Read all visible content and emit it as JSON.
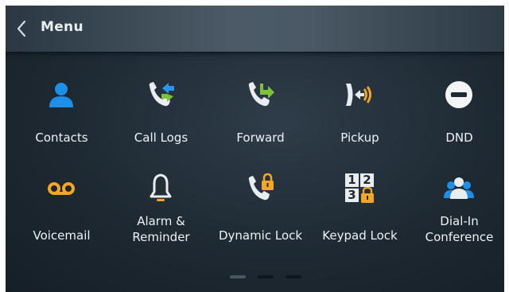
{
  "header": {
    "title": "Menu"
  },
  "menu": {
    "items": [
      {
        "label": "Contacts",
        "icon": "contacts-icon"
      },
      {
        "label": "Call Logs",
        "icon": "call-logs-icon"
      },
      {
        "label": "Forward",
        "icon": "forward-icon"
      },
      {
        "label": "Pickup",
        "icon": "pickup-icon"
      },
      {
        "label": "DND",
        "icon": "dnd-icon"
      },
      {
        "label": "Voicemail",
        "icon": "voicemail-icon"
      },
      {
        "label_line1": "Alarm &",
        "label_line2": "Reminder",
        "icon": "alarm-bell-icon"
      },
      {
        "label": "Dynamic Lock",
        "icon": "dynamic-lock-icon"
      },
      {
        "label": "Keypad Lock",
        "icon": "keypad-lock-icon"
      },
      {
        "label_line1": "Dial-In",
        "label_line2": "Conference",
        "icon": "conference-icon"
      }
    ]
  },
  "keypad_icon": {
    "keys": [
      "1",
      "2",
      "3"
    ]
  },
  "pager": {
    "pages": 3,
    "active_page": 1
  },
  "colors": {
    "header_text": "#e9eef2",
    "label_text": "#eef2f5",
    "contacts_blue": "#1e8fe8",
    "call_green": "#7ec23a",
    "call_blue": "#2596f0",
    "accent_orange": "#f5a623",
    "phone_white": "#e9edf0",
    "dnd_white": "#f2f4f6",
    "background": "#1e2932"
  }
}
